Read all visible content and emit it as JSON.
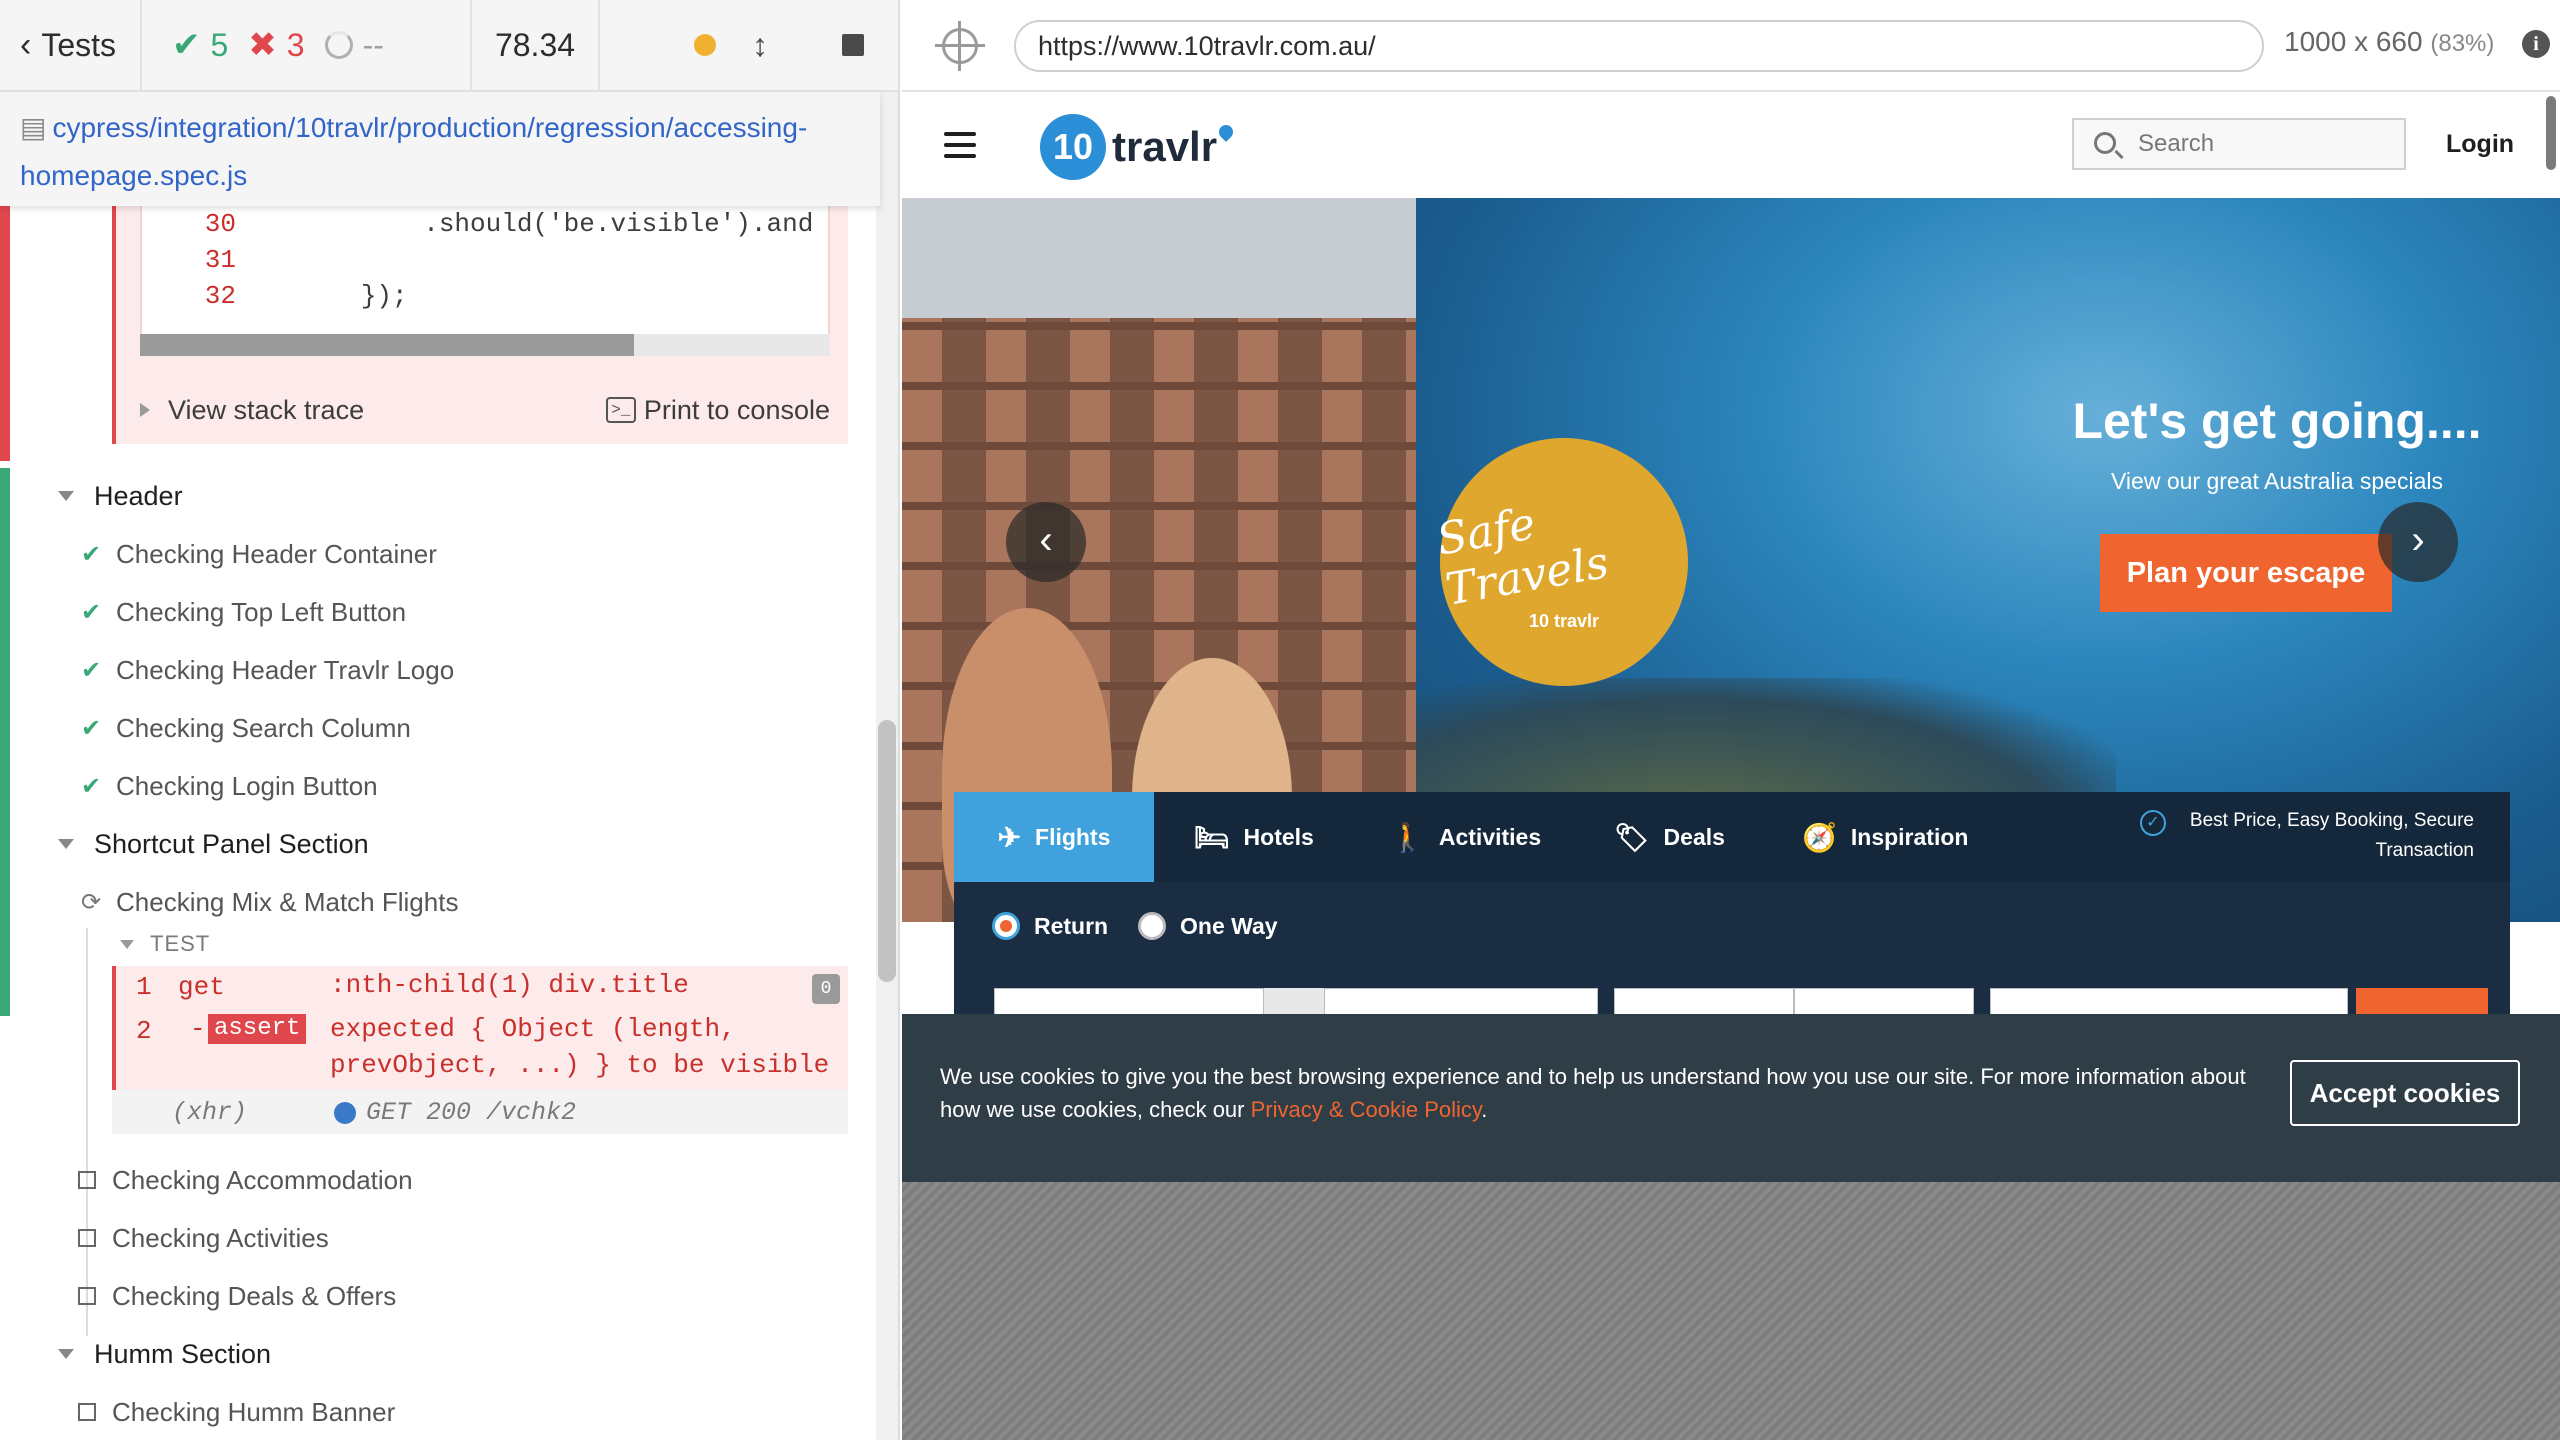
{
  "reporter": {
    "tests_label": "Tests",
    "passed": "5",
    "failed": "3",
    "pending": "--",
    "duration": "78.34",
    "spec_path": "cypress/integration/10travlr/production/regression/accessing-homepage.spec.js",
    "error_code": [
      {
        "ln": "30",
        "code": "            .should('be.visible').and"
      },
      {
        "ln": "31",
        "code": ""
      },
      {
        "ln": "32",
        "code": "        });"
      }
    ],
    "view_stack_trace": "View stack trace",
    "print_to_console": "Print to console",
    "suites": {
      "header": {
        "title": "Header",
        "tests": [
          "Checking Header Container",
          "Checking Top Left Button",
          "Checking Header Travlr Logo",
          "Checking Search Column",
          "Checking Login Button"
        ]
      },
      "shortcut": {
        "title": "Shortcut Panel Section",
        "running_test": "Checking Mix & Match Flights",
        "test_label": "TEST",
        "commands": {
          "cmd1_num": "1",
          "cmd1_name": "get",
          "cmd1_msg": ":nth-child(1) div.title",
          "cmd1_count": "0",
          "cmd2_num": "2",
          "cmd2_dash": "-",
          "cmd2_name": "assert",
          "cmd2_msg_line1": "expected { Object (length,",
          "cmd2_msg_line2": "prevObject, ...) } to be visible",
          "xhr_label": "(xhr)",
          "xhr_msg": "GET 200 /vchk2"
        },
        "pending_tests": [
          "Checking Accommodation",
          "Checking Activities",
          "Checking Deals & Offers"
        ]
      },
      "humm": {
        "title": "Humm Section",
        "tests": [
          "Checking Humm Banner"
        ]
      }
    }
  },
  "aut": {
    "url": "https://www.10travlr.com.au/",
    "viewport": "1000 x 660",
    "scale": "(83%)",
    "info_icon": "i"
  },
  "site": {
    "logo_mark": "10",
    "logo_text": "travlr",
    "search_placeholder": "Search",
    "login": "Login",
    "hero_title": "Let's get going....",
    "hero_subtitle": "View our great Australia specials",
    "hero_cta": "Plan your escape",
    "badge_text": "Safe Travels",
    "badge_logo": "10 travlr",
    "arrow_prev": "‹",
    "arrow_next": "›",
    "booking_tabs": [
      {
        "label": "Flights",
        "icon": "✈"
      },
      {
        "label": "Hotels",
        "icon": "🛏"
      },
      {
        "label": "Activities",
        "icon": "🚶"
      },
      {
        "label": "Deals",
        "icon": "🏷"
      },
      {
        "label": "Inspiration",
        "icon": "🧭"
      }
    ],
    "promo_line1": "Best Price, Easy Booking, Secure",
    "promo_line2": "Transaction",
    "trip_return": "Return",
    "trip_oneway": "One Way",
    "cookie_text": "We use cookies to give you the best browsing experience and to help us understand how you use our site. For more information about how we use cookies, check our ",
    "cookie_link": "Privacy & Cookie Policy",
    "cookie_period": ".",
    "cookie_button": "Accept cookies"
  },
  "colors": {
    "pass": "#3aa777",
    "fail": "#e0474c",
    "accent_orange": "#f0652f",
    "booking_blue": "#3fa2dc"
  }
}
